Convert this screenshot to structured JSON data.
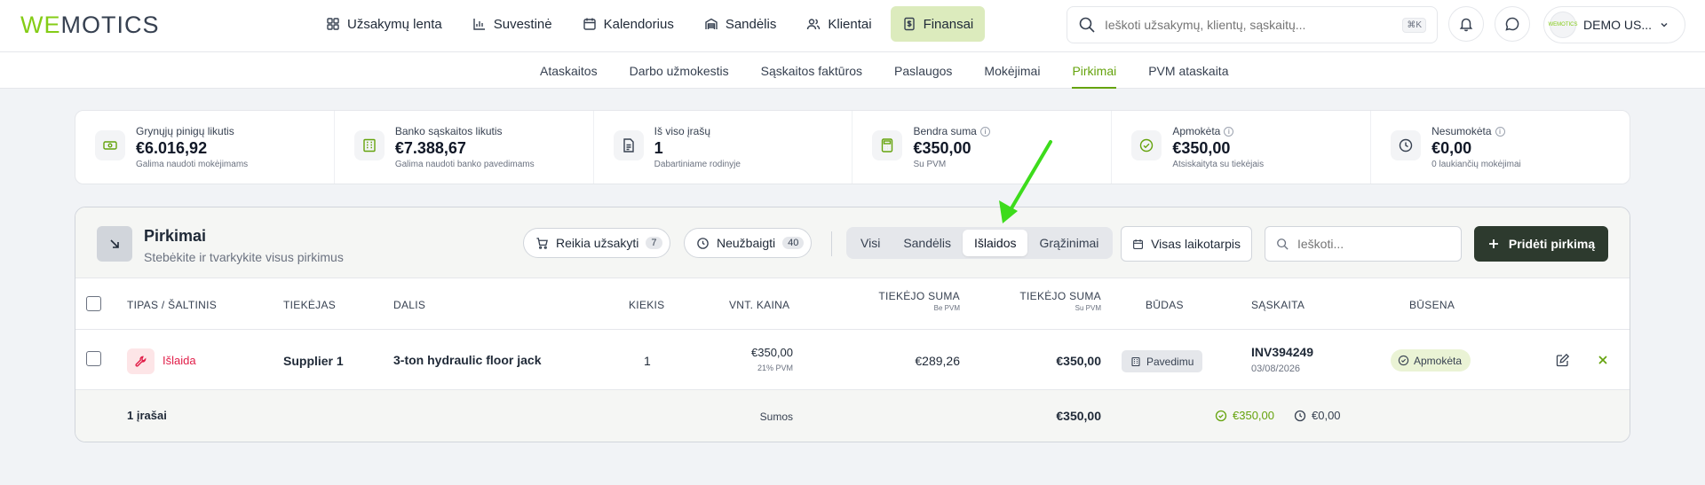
{
  "brand": {
    "logo_we": "WE",
    "logo_rest": "MOTICS",
    "accent": "#84cc16",
    "dark_button": "#2d3a2e"
  },
  "nav": {
    "items": [
      {
        "label": "Užsakymų lenta",
        "icon": "grid-icon"
      },
      {
        "label": "Suvestinė",
        "icon": "bar-chart-icon"
      },
      {
        "label": "Kalendorius",
        "icon": "calendar-icon"
      },
      {
        "label": "Sandėlis",
        "icon": "warehouse-icon"
      },
      {
        "label": "Klientai",
        "icon": "users-icon"
      },
      {
        "label": "Finansai",
        "icon": "finance-icon",
        "active": true
      }
    ]
  },
  "search": {
    "placeholder": "Ieškoti užsakymų, klientų, sąskaitų...",
    "shortcut": "⌘K"
  },
  "user": {
    "name": "DEMO US...",
    "avatar_text": "WEMOTICS"
  },
  "subnav": {
    "items": [
      "Ataskaitos",
      "Darbo užmokestis",
      "Sąskaitos faktūros",
      "Paslaugos",
      "Mokėjimai",
      "Pirkimai",
      "PVM ataskaita"
    ],
    "active": "Pirkimai"
  },
  "stats": [
    {
      "label": "Grynųjų pinigų likutis",
      "value": "€6.016,92",
      "sub": "Galima naudoti mokėjimams",
      "icon": "cash-icon",
      "info": false
    },
    {
      "label": "Banko sąskaitos likutis",
      "value": "€7.388,67",
      "sub": "Galima naudoti banko pavedimams",
      "icon": "bank-icon",
      "info": false
    },
    {
      "label": "Iš viso įrašų",
      "value": "1",
      "sub": "Dabartiniame rodinyje",
      "icon": "document-icon",
      "info": false
    },
    {
      "label": "Bendra suma",
      "value": "€350,00",
      "sub": "Su PVM",
      "icon": "calculator-icon",
      "info": true
    },
    {
      "label": "Apmokėta",
      "value": "€350,00",
      "sub": "Atsiskaityta su tiekėjais",
      "icon": "check-circle-icon",
      "info": true
    },
    {
      "label": "Nesumokėta",
      "value": "€0,00",
      "sub": "0 laukiančių mokėjimai",
      "icon": "clock-icon",
      "info": true
    }
  ],
  "card": {
    "title": "Pirkimai",
    "subtitle": "Stebėkite ir tvarkykite visus pirkimus",
    "chips": [
      {
        "label": "Reikia užsakyti",
        "count": "7",
        "icon": "cart-icon"
      },
      {
        "label": "Neužbaigti",
        "count": "40",
        "icon": "clock-icon"
      }
    ],
    "segments": [
      "Visi",
      "Sandėlis",
      "Išlaidos",
      "Grąžinimai"
    ],
    "active_segment": "Išlaidos",
    "period_label": "Visas laikotarpis",
    "search_placeholder": "Ieškoti...",
    "add_label": "Pridėti pirkimą"
  },
  "table": {
    "headers": {
      "type": "TIPAS / ŠALTINIS",
      "supplier": "TIEKĖJAS",
      "part": "DALIS",
      "qty": "KIEKIS",
      "unit_price": "VNT. KAINA",
      "sum_excl": "TIEKĖJO SUMA",
      "sum_excl_sub": "Be PVM",
      "sum_incl": "TIEKĖJO SUMA",
      "sum_incl_sub": "Su PVM",
      "method": "BŪDAS",
      "invoice": "SĄSKAITA",
      "status": "BŪSENA"
    },
    "rows": [
      {
        "type": "Išlaida",
        "supplier": "Supplier 1",
        "part": "3-ton hydraulic floor jack",
        "qty": "1",
        "unit_price": "€350,00",
        "unit_price_vat": "21% PVM",
        "sum_excl": "€289,26",
        "sum_incl": "€350,00",
        "method": "Pavedimu",
        "invoice": "INV394249",
        "invoice_date": "03/08/2026",
        "status": "Apmokėta"
      }
    ],
    "footer": {
      "count_label": "1 įrašai",
      "sums_label": "Sumos",
      "total": "€350,00",
      "paid": "€350,00",
      "unpaid": "€0,00"
    }
  },
  "colors": {
    "type_red": "#e11d48",
    "paid_green": "#65a30d",
    "annotation_arrow": "#3ddc1c"
  }
}
